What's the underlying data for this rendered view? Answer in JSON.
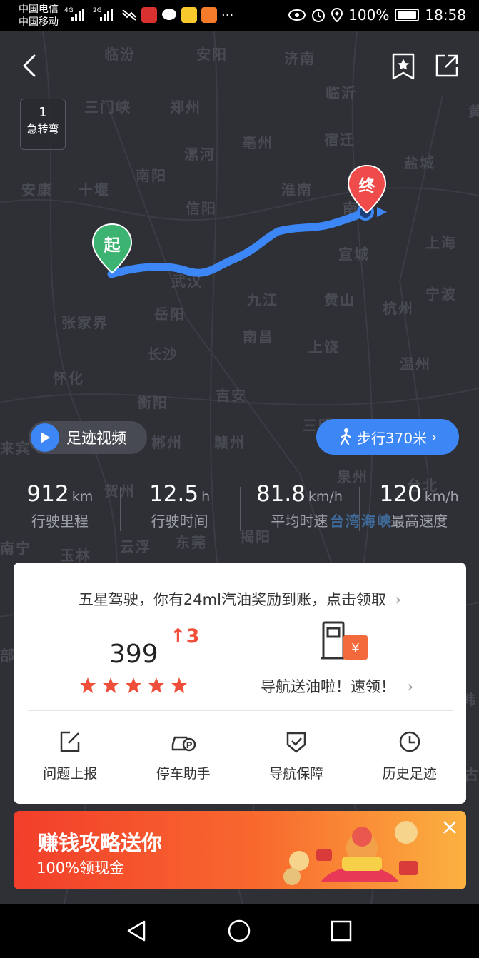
{
  "statusbar": {
    "carrier1": "中国电信",
    "carrier2": "中国移动",
    "net1": "4G",
    "net2": "2G",
    "battery": "100%",
    "time": "18:58"
  },
  "map": {
    "cities": [
      "临汾",
      "安阳",
      "济南",
      "临沂",
      "三门峡",
      "郑州",
      "亳州",
      "宿迁",
      "漯河",
      "南阳",
      "淮南",
      "盐城",
      "安康",
      "十堰",
      "信阳",
      "南京",
      "上海",
      "武汉",
      "宣城",
      "九江",
      "黄山",
      "杭州",
      "宁波",
      "张家界",
      "岳阳",
      "南昌",
      "上饶",
      "长沙",
      "温州",
      "怀化",
      "衡阳",
      "吉安",
      "三明",
      "郴州",
      "赣州",
      "泉州",
      "台北",
      "贺州",
      "台湾海峡",
      "南宁",
      "玉林",
      "云浮",
      "东莞",
      "揭阳",
      "黄",
      "来宾",
      "郑",
      "部",
      "古",
      "韩"
    ],
    "start_label": "起",
    "end_label": "终",
    "turn_count": "1",
    "turn_label": "急转弯",
    "video_button": "足迹视频",
    "walk_button": "步行370米"
  },
  "stats": [
    {
      "value": "912",
      "unit": "km",
      "label": "行驶里程"
    },
    {
      "value": "12.5",
      "unit": "h",
      "label": "行驶时间"
    },
    {
      "value": "81.8",
      "unit": "km/h",
      "label": "平均时速"
    },
    {
      "value": "120",
      "unit": "km/h",
      "label": "最高速度"
    }
  ],
  "card": {
    "reward_text": "五星驾驶，你有24ml汽油奖励到账，点击领取",
    "score": "399",
    "score_increase": "3",
    "stars": 5,
    "promo": "导航送油啦！速领！",
    "tools": [
      "问题上报",
      "停车助手",
      "导航保障",
      "历史足迹"
    ]
  },
  "banner": {
    "title": "赚钱攻略送你",
    "subtitle": "100%领现金"
  },
  "colors": {
    "route": "#3d86f5",
    "start_pin": "#3cb371",
    "end_pin": "#ef4b4b",
    "accent": "#ef4e3a"
  }
}
